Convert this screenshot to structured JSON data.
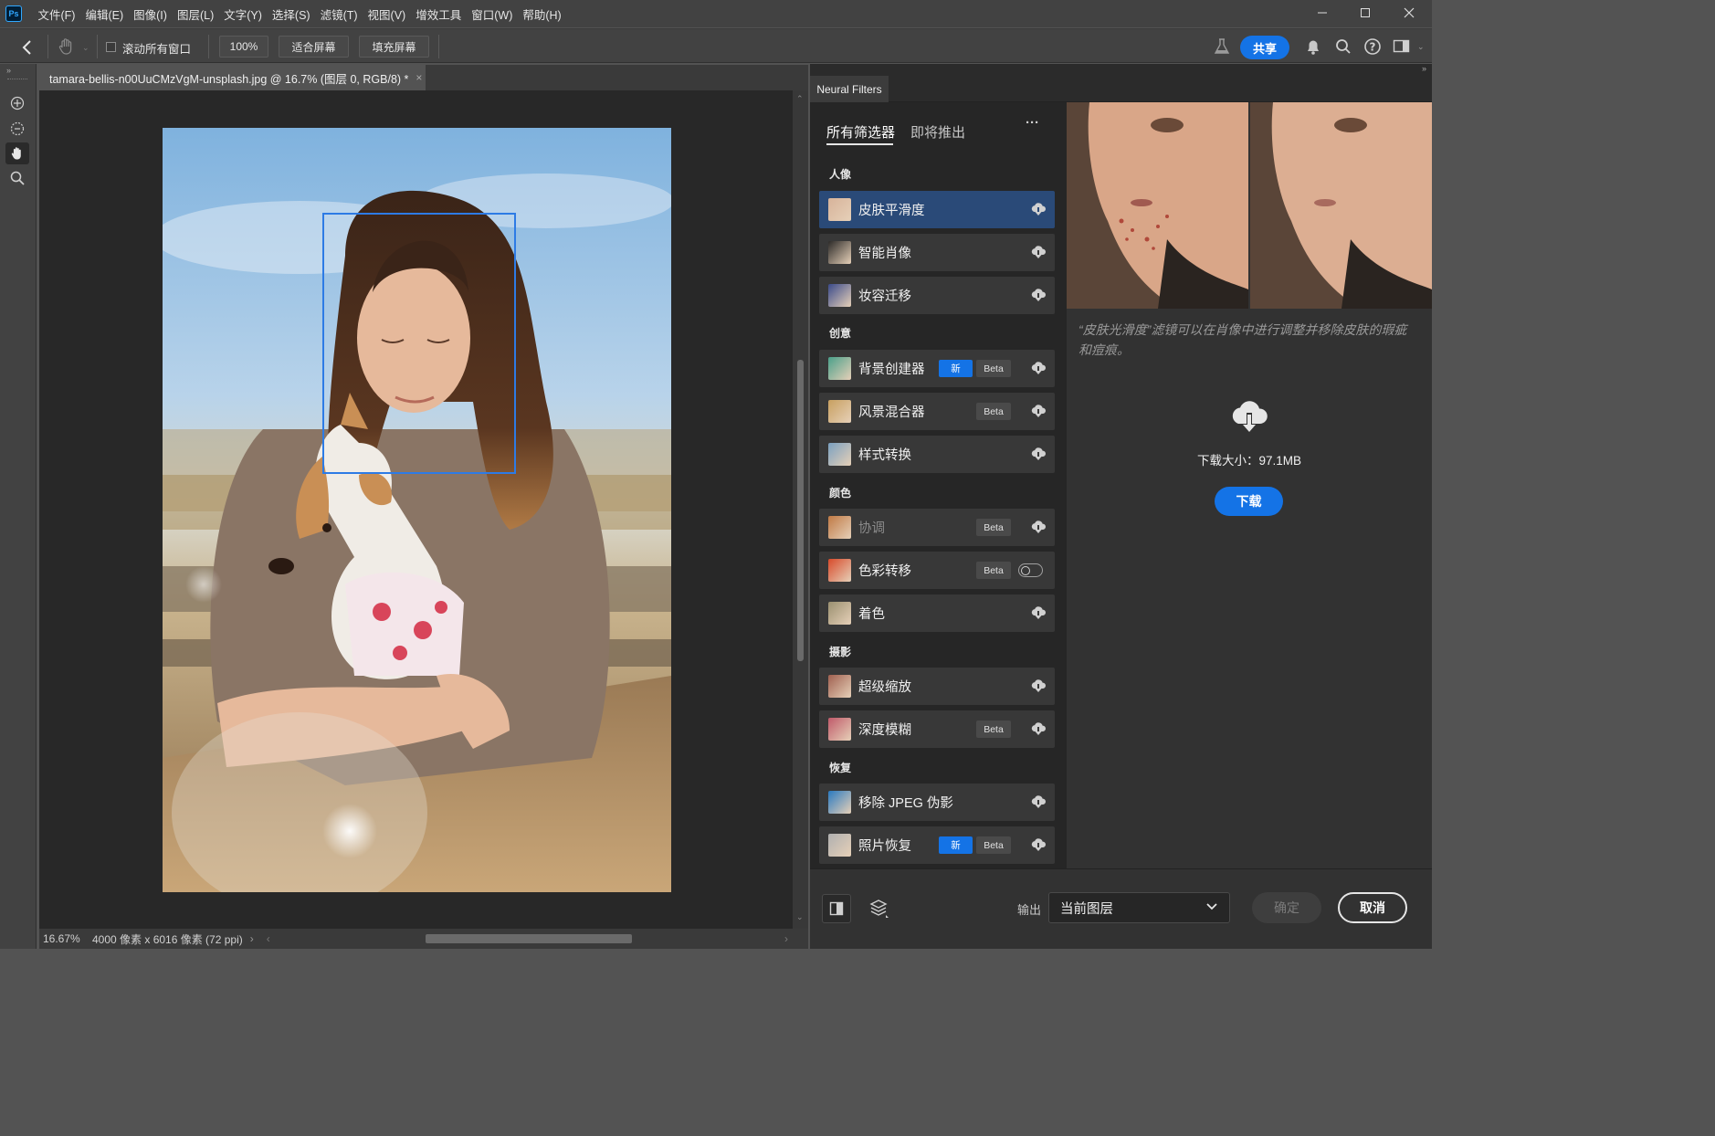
{
  "app": {
    "logo": "Ps"
  },
  "menu": [
    "文件(F)",
    "编辑(E)",
    "图像(I)",
    "图层(L)",
    "文字(Y)",
    "选择(S)",
    "滤镜(T)",
    "视图(V)",
    "增效工具",
    "窗口(W)",
    "帮助(H)"
  ],
  "window_controls": [
    "minimize-icon",
    "maximize-icon",
    "close-icon"
  ],
  "options_bar": {
    "scroll_all_label": "滚动所有窗口",
    "scroll_all_checked": false,
    "zoom_100": "100%",
    "fit_screen": "适合屏幕",
    "fill_screen": "填充屏幕",
    "share": "共享",
    "share_color": "#1473e6"
  },
  "document": {
    "tab_title": "tamara-bellis-n00UuCMzVgM-unsplash.jpg @ 16.7% (图层 0, RGB/8) *",
    "tab_close": "×",
    "status_zoom": "16.67%",
    "status_info": "4000 像素 x 6016 像素 (72 ppi)",
    "face_box_color": "#2d7be5"
  },
  "toolbar": [
    "move-icon",
    "lasso-icon",
    "hand-icon",
    "zoom-icon"
  ],
  "neural_filters": {
    "panel_tab": "Neural Filters",
    "tabs": [
      "所有筛选器",
      "即将推出"
    ],
    "more": "···",
    "categories": [
      {
        "name": "人像",
        "items": [
          {
            "label": "皮肤平滑度",
            "selected": true,
            "new": false,
            "beta": false,
            "control": "cloud"
          },
          {
            "label": "智能肖像",
            "selected": false,
            "new": false,
            "beta": false,
            "control": "cloud"
          },
          {
            "label": "妆容迁移",
            "selected": false,
            "new": false,
            "beta": false,
            "control": "cloud"
          }
        ]
      },
      {
        "name": "创意",
        "items": [
          {
            "label": "背景创建器",
            "selected": false,
            "new": true,
            "beta": true,
            "control": "cloud"
          },
          {
            "label": "风景混合器",
            "selected": false,
            "new": false,
            "beta": true,
            "control": "cloud"
          },
          {
            "label": "样式转换",
            "selected": false,
            "new": false,
            "beta": false,
            "control": "cloud"
          }
        ]
      },
      {
        "name": "颜色",
        "items": [
          {
            "label": "协调",
            "selected": false,
            "new": false,
            "beta": true,
            "control": "cloud",
            "dim": true
          },
          {
            "label": "色彩转移",
            "selected": false,
            "new": false,
            "beta": true,
            "control": "toggle"
          },
          {
            "label": "着色",
            "selected": false,
            "new": false,
            "beta": false,
            "control": "cloud"
          }
        ]
      },
      {
        "name": "摄影",
        "items": [
          {
            "label": "超级缩放",
            "selected": false,
            "new": false,
            "beta": false,
            "control": "cloud"
          },
          {
            "label": "深度模糊",
            "selected": false,
            "new": false,
            "beta": true,
            "control": "cloud"
          }
        ]
      },
      {
        "name": "恢复",
        "items": [
          {
            "label": "移除 JPEG 伪影",
            "selected": false,
            "new": false,
            "beta": false,
            "control": "cloud"
          },
          {
            "label": "照片恢复",
            "selected": false,
            "new": true,
            "beta": true,
            "control": "cloud"
          }
        ]
      }
    ],
    "badge_new": "新",
    "badge_beta": "Beta",
    "description": "“皮肤光滑度”滤镜可以在肖像中进行调整并移除皮肤的瑕疵和痘痕。",
    "download_size": "下载大小：97.1MB",
    "download_button": "下载",
    "output_label": "输出",
    "output_value": "当前图层",
    "ok_button": "确定",
    "cancel_button": "取消"
  }
}
